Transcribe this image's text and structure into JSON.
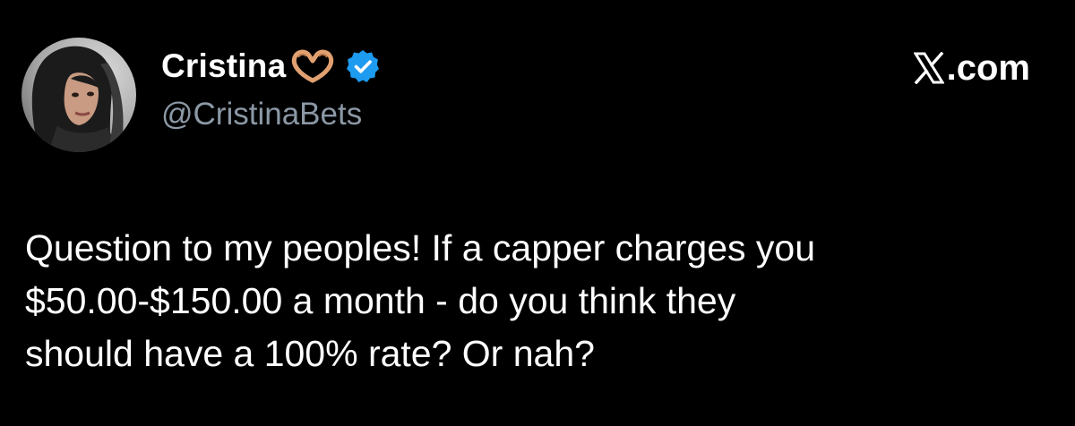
{
  "author": {
    "display_name": "Cristina",
    "handle": "@CristinaBets",
    "name_emoji": "heart-hands-icon",
    "verified": true,
    "verified_color": "#1d9bf0",
    "avatar": "profile-photo"
  },
  "source": {
    "logo": "x-logo-icon",
    "domain": ".com"
  },
  "tweet": {
    "lines": [
      "Question to my peoples! If a capper charges you",
      "$50.00-$150.00 a month - do you think they",
      "should have a 100% rate? Or nah?"
    ]
  },
  "colors": {
    "background": "#000000",
    "text": "#ffffff",
    "secondary_text": "#8b98a5",
    "verified": "#1d9bf0",
    "emoji_skin": "#e0a070"
  }
}
